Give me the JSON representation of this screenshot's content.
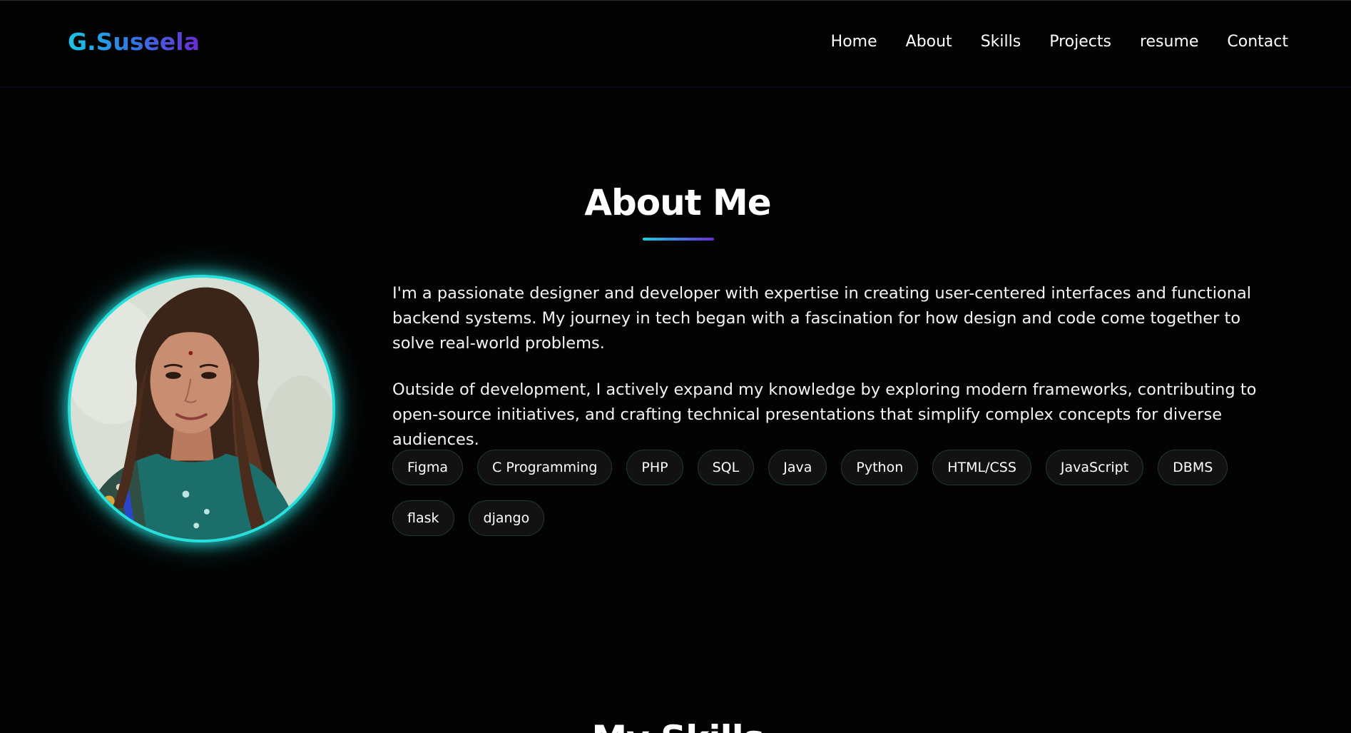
{
  "brand": "G.Suseela",
  "nav": [
    "Home",
    "About",
    "Skills",
    "Projects",
    "resume",
    "Contact"
  ],
  "about": {
    "title": "About Me",
    "paragraph1": "I'm a passionate designer and developer with expertise in creating user-centered interfaces and functional backend systems. My journey in tech began with a fascination for how design and code come together to solve real-world problems.",
    "paragraph2": "Outside of development, I actively expand my knowledge by exploring modern frameworks, contributing to open-source initiatives, and crafting technical presentations that simplify complex concepts for diverse audiences.",
    "skills": [
      "Figma",
      "C Programming",
      "PHP",
      "SQL",
      "Java",
      "Python",
      "HTML/CSS",
      "JavaScript",
      "DBMS",
      "flask",
      "django"
    ]
  },
  "next_section_title": "My Skills",
  "colors": {
    "background": "#030303",
    "accent_cyan": "#26e0dc",
    "accent_purple": "#6d2bd6",
    "chip_border": "#1e3a3a"
  }
}
